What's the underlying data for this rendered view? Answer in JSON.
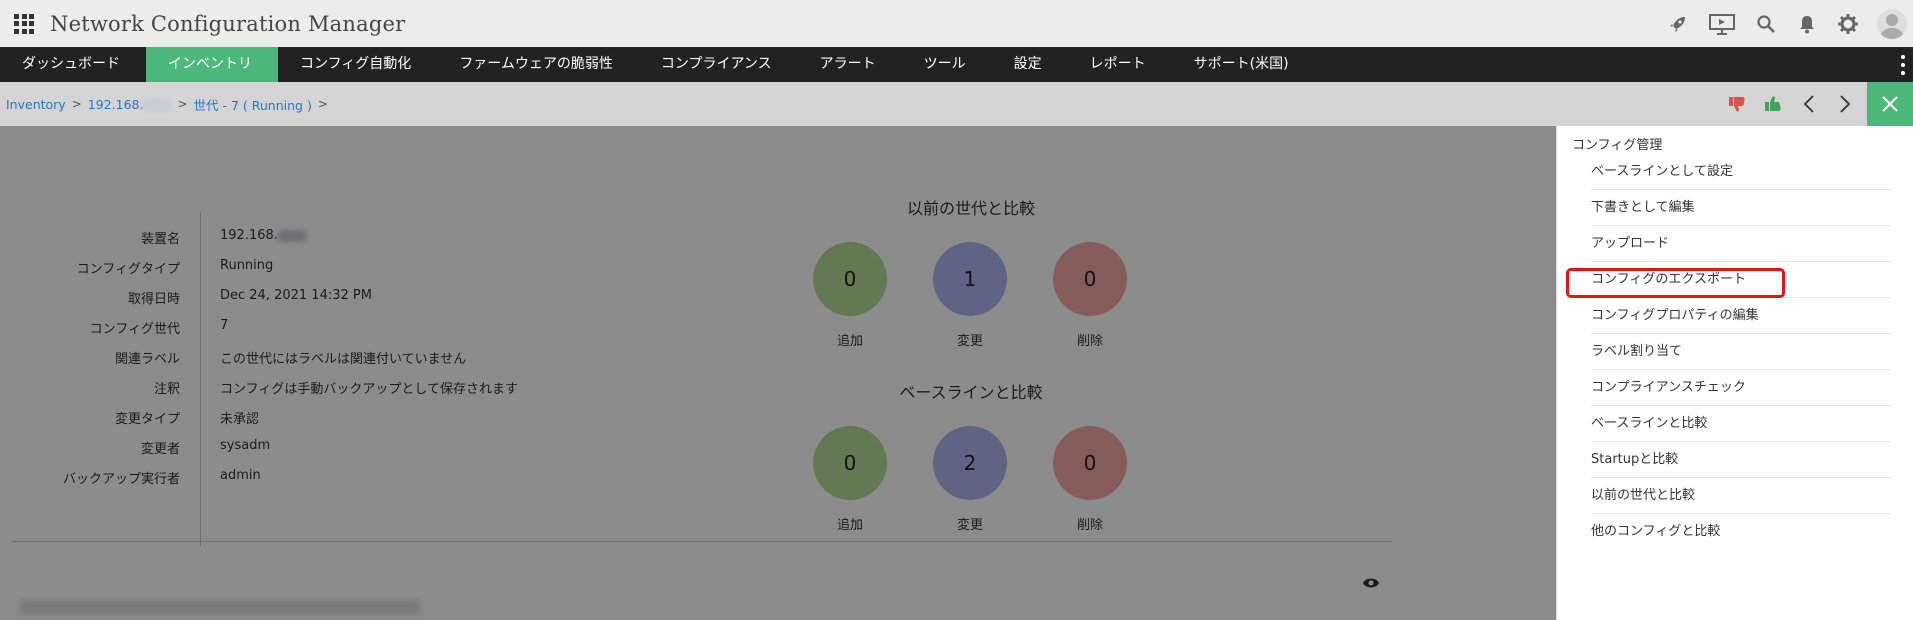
{
  "app": {
    "title": "Network Configuration Manager"
  },
  "topbar_icons": [
    "rocket-icon",
    "presentation-icon",
    "search-icon",
    "bell-icon",
    "gear-icon",
    "avatar"
  ],
  "nav": {
    "items": [
      {
        "label": "ダッシュボード",
        "active": false
      },
      {
        "label": "インベントリ",
        "active": true
      },
      {
        "label": "コンフィグ自動化",
        "active": false
      },
      {
        "label": "ファームウェアの脆弱性",
        "active": false
      },
      {
        "label": "コンプライアンス",
        "active": false
      },
      {
        "label": "アラート",
        "active": false
      },
      {
        "label": "ツール",
        "active": false
      },
      {
        "label": "設定",
        "active": false
      },
      {
        "label": "レポート",
        "active": false
      },
      {
        "label": "サポート(米国)",
        "active": false
      }
    ]
  },
  "breadcrumb": {
    "items": [
      "Inventory",
      "192.168.",
      "世代 - 7 ( Running )"
    ]
  },
  "details": {
    "rows": [
      {
        "label": "装置名",
        "value": "192.168."
      },
      {
        "label": "コンフィグタイプ",
        "value": "Running"
      },
      {
        "label": "取得日時",
        "value": "Dec 24, 2021 14:32 PM"
      },
      {
        "label": "コンフィグ世代",
        "value": "7"
      },
      {
        "label": "関連ラベル",
        "value": "この世代にはラベルは関連付いていません"
      },
      {
        "label": "注釈",
        "value": "コンフィグは手動バックアップとして保存されます"
      },
      {
        "label": "変更タイプ",
        "value": "未承認"
      },
      {
        "label": "変更者",
        "value": "sysadm"
      },
      {
        "label": "バックアップ実行者",
        "value": "admin"
      }
    ]
  },
  "compare_prev": {
    "title": "以前の世代と比較",
    "added": {
      "count": "0",
      "label": "追加"
    },
    "changed": {
      "count": "1",
      "label": "変更"
    },
    "deleted": {
      "count": "0",
      "label": "削除"
    }
  },
  "compare_baseline": {
    "title": "ベースラインと比較",
    "added": {
      "count": "0",
      "label": "追加"
    },
    "changed": {
      "count": "2",
      "label": "変更"
    },
    "deleted": {
      "count": "0",
      "label": "削除"
    }
  },
  "panel": {
    "heading": "コンフィグ管理",
    "items": [
      "ベースラインとして設定",
      "下書きとして編集",
      "アップロード",
      "コンフィグのエクスポート",
      "コンフィグプロパティの編集",
      "ラベル割り当て",
      "コンプライアンスチェック",
      "ベースラインと比較",
      "Startupと比較",
      "以前の世代と比較",
      "他のコンフィグと比較"
    ],
    "highlighted_index": 3
  },
  "colors": {
    "accent": "#4cb87b",
    "nav_bg": "#222222",
    "highlight": "#e01515",
    "added": "#b4dd9a",
    "changed": "#aeb6f2",
    "deleted": "#f2a8a2"
  }
}
